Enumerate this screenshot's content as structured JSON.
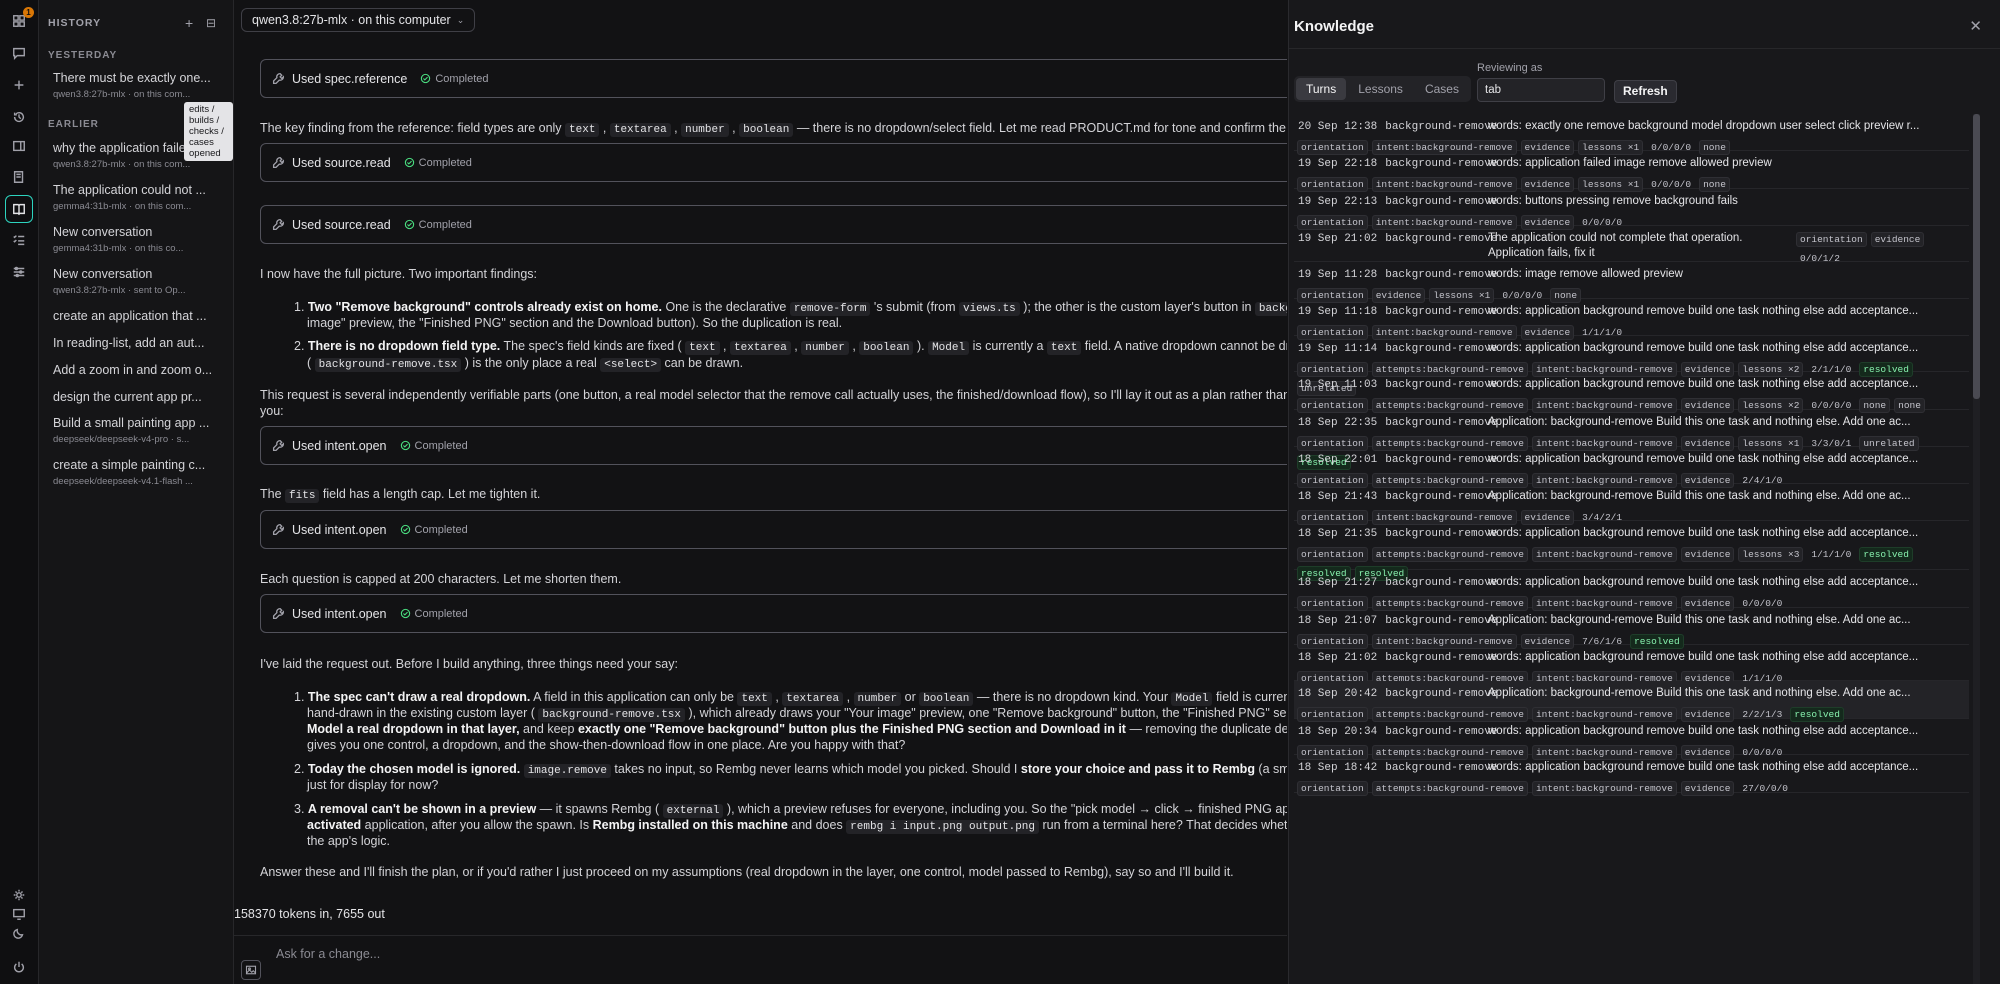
{
  "model_selector": "qwen3.8:27b-mlx · on this computer",
  "sidebar": {
    "title": "HISTORY",
    "tooltip": "edits / builds / checks / cases opened",
    "sections": {
      "yesterday": "YESTERDAY",
      "earlier": "EARLIER"
    },
    "items": [
      {
        "title": "There must be exactly one...",
        "sub": "qwen3.8:27b-mlx · on this com..."
      },
      {
        "title": "why the application failed i...",
        "sub": "qwen3.8:27b-mlx · on this com..."
      },
      {
        "title": "The application could not ...",
        "sub": "gemma4:31b-mlx · on this com..."
      },
      {
        "title": "New conversation",
        "sub": "gemma4:31b-mlx · on this co..."
      },
      {
        "title": "New conversation",
        "sub": "qwen3.8:27b-mlx · sent to Op..."
      },
      {
        "title": "create an application that ...",
        "sub": ""
      },
      {
        "title": "In reading-list, add an aut...",
        "sub": ""
      },
      {
        "title": "Add a zoom in and zoom o...",
        "sub": ""
      },
      {
        "title": "design the current app pr...",
        "sub": ""
      },
      {
        "title": "Build a small painting app ...",
        "sub": "deepseek/deepseek-v4-pro · s..."
      },
      {
        "title": "create a simple painting c...",
        "sub": "deepseek/deepseek-v4.1-flash ..."
      }
    ]
  },
  "chat": {
    "completed": "Completed",
    "tools": [
      "Used spec.reference",
      "Used source.read",
      "Used source.read",
      "Used intent.open",
      "Used intent.open",
      "Used intent.open"
    ],
    "m1": {
      "a": "The key finding from the reference: field types are only ",
      "c1": "text",
      "c2": "textarea",
      "c3": "number",
      "c4": "boolean",
      "b": " — there is no dropdown/select field. Let me read PRODUCT.md for tone and confirm the two-butt"
    },
    "m2": "I now have the full picture. Two important findings:",
    "f1": {
      "b": "Two \"Remove background\" controls already exist on home.",
      "t1": " One is the declarative ",
      "c1": "remove-form",
      "t2": " 's submit (from ",
      "c2": "views.ts",
      "t3": " ); the other is the custom layer's button in ",
      "c3": "background-re",
      "t4": "image\" preview, the \"Finished PNG\" section and the Download button). So the duplication is real."
    },
    "f2": {
      "b": "There is no dropdown field type.",
      "t1": " The spec's field kinds are fixed ( ",
      "c1": "text",
      "c2": "textarea",
      "c3": "number",
      "c4": "boolean",
      "t2": " ). ",
      "c5": "Model",
      "t3": " is currently a ",
      "c6": "text",
      "t4": " field. A native dropdown cannot be drawn from",
      "t5": "( ",
      "c7": "background-remove.tsx",
      "t6": " ) is the only place a real ",
      "c8": "<select>",
      "t7": " can be drawn."
    },
    "m3a": "This request is several independently verifiable parts (one button, a real model selector that the remove call actually uses, the finished/download flow), so I'll lay it out as a plan rather than start e",
    "m3b": "you:",
    "m4a": "The ",
    "m4c": "fits",
    "m4b": " field has a length cap. Let me tighten it.",
    "m5": "Each question is capped at 200 characters. Let me shorten them.",
    "m6": "I've laid the request out. Before I build anything, three things need your say:",
    "q1": {
      "b": "The spec can't draw a real dropdown.",
      "t1": " A field in this application can only be ",
      "c1": "text",
      "c2": "textarea",
      "c3": "number",
      "or": " or ",
      "c4": "boolean",
      "t2": " — there is no dropdown kind. Your ",
      "c5": "Model",
      "t3": " field is currently a pla",
      "l2a": "hand-drawn in the existing custom layer ( ",
      "c6": "background-remove.tsx",
      "l2b": " ), which already draws your \"Your image\" preview, one \"Remove background\" button, the \"Finished PNG\" section and th",
      "l3b": "Model a real dropdown in that layer,",
      "l3t": " and keep ",
      "l3b2": "exactly one \"Remove background\" button plus the Finished PNG section and Download in it",
      "l3t2": " — removing the duplicate declarative form a",
      "l4": "gives you one control, a dropdown, and the show-then-download flow in one place. Are you happy with that?"
    },
    "q2": {
      "b": "Today the chosen model is ignored.",
      "c1": "image.remove",
      "t1": " takes no input, so Rembg never learns which model you picked. Should I ",
      "b2": "store your choice and pass it to Rembg",
      "t2": " (a small new inpu",
      "l2": "just for display for now?"
    },
    "q3": {
      "b": "A removal can't be shown in a preview",
      "t1": " — it spawns Rembg ( ",
      "c1": "external",
      "t2": " ), which a preview refuses for everyone, including you. So the \"pick model → click → finished PNG appears → do",
      "l2b": "activated",
      "l2t": " application, after you allow the spawn. Is ",
      "l2b2": "Rembg installed on this machine",
      "l2t2": " and does ",
      "c2": "rembg i input.png output.png",
      "l2t3": " run from a terminal here? That decides whether a finishe",
      "l3": "the app's logic."
    },
    "m7": "Answer these and I'll finish the plan, or if you'd rather I just proceed on my assumptions (real dropdown in the layer, one control, model passed to Rembg), say so and I'll build it.",
    "tokens": "158370 tokens in, 7655 out",
    "composer_placeholder": "Ask for a change..."
  },
  "knowledge": {
    "title": "Knowledge",
    "tabs": [
      "Turns",
      "Lessons",
      "Cases"
    ],
    "reviewing_label": "Reviewing as",
    "reviewing_value": "tab",
    "refresh": "Refresh",
    "rows": [
      {
        "date": "20 Sep 12:38",
        "cat": "background-remove",
        "text": "words: exactly one remove background model dropdown user select click preview r...",
        "tags": [
          "orientation",
          "intent:background-remove",
          "evidence",
          "lessons ×1",
          "0/0/0/0",
          "none"
        ]
      },
      {
        "date": "19 Sep 22:18",
        "cat": "background-remove",
        "text": "words: application failed image remove allowed preview",
        "tags": [
          "orientation",
          "intent:background-remove",
          "evidence",
          "lessons ×1",
          "0/0/0/0",
          "none"
        ]
      },
      {
        "date": "19 Sep 22:13",
        "cat": "background-remove",
        "text": "words: buttons pressing remove background fails",
        "tags": [
          "orientation",
          "intent:background-remove",
          "evidence",
          "0/0/0/0"
        ]
      },
      {
        "date": "19 Sep 21:02",
        "cat": "background-remove",
        "text": "The application could not complete that operation.",
        "text2": "Application fails, fix it",
        "tags": []
      },
      {
        "date": "19 Sep 11:28",
        "cat": "background-remove",
        "text": "words: image remove allowed preview",
        "tags": [
          "orientation",
          "evidence",
          "lessons ×1",
          "0/0/0/0",
          "none"
        ]
      },
      {
        "date": "19 Sep 11:18",
        "cat": "background-remove",
        "text": "words: application background remove build one task nothing else add acceptance...",
        "tags": [
          "orientation",
          "intent:background-remove",
          "evidence",
          "1/1/1/0"
        ]
      },
      {
        "date": "19 Sep 11:14",
        "cat": "background-remove",
        "text": "words: application background remove build one task nothing else add acceptance...",
        "tags": [
          "orientation",
          "attempts:background-remove",
          "intent:background-remove",
          "evidence",
          "lessons ×2",
          "2/1/1/0",
          "resolved",
          "unrelated"
        ]
      },
      {
        "date": "19 Sep 11:03",
        "cat": "background-remove",
        "text": "words: application background remove build one task nothing else add acceptance...",
        "tags": [
          "orientation",
          "attempts:background-remove",
          "intent:background-remove",
          "evidence",
          "lessons ×2",
          "0/0/0/0",
          "none",
          "none"
        ]
      },
      {
        "date": "18 Sep 22:35",
        "cat": "background-remove",
        "text": "Application: background-remove Build this one task and nothing else. Add one ac...",
        "tags": [
          "orientation",
          "attempts:background-remove",
          "intent:background-remove",
          "evidence",
          "lessons ×1",
          "3/3/0/1",
          "unrelated",
          "resolved"
        ]
      },
      {
        "date": "18 Sep 22:01",
        "cat": "background-remove",
        "text": "words: application background remove build one task nothing else add acceptance...",
        "tags": [
          "orientation",
          "attempts:background-remove",
          "intent:background-remove",
          "evidence",
          "2/4/1/0"
        ]
      },
      {
        "date": "18 Sep 21:43",
        "cat": "background-remove",
        "text": "Application: background-remove Build this one task and nothing else. Add one ac...",
        "tags": [
          "orientation",
          "intent:background-remove",
          "evidence",
          "3/4/2/1"
        ]
      },
      {
        "date": "18 Sep 21:35",
        "cat": "background-remove",
        "text": "words: application background remove build one task nothing else add acceptance...",
        "tags": [
          "orientation",
          "attempts:background-remove",
          "intent:background-remove",
          "evidence",
          "lessons ×3",
          "1/1/1/0",
          "resolved",
          "resolved",
          "resolved"
        ]
      },
      {
        "date": "18 Sep 21:27",
        "cat": "background-remove",
        "text": "words: application background remove build one task nothing else add acceptance...",
        "tags": [
          "orientation",
          "attempts:background-remove",
          "intent:background-remove",
          "evidence",
          "0/0/0/0"
        ]
      },
      {
        "date": "18 Sep 21:07",
        "cat": "background-remove",
        "text": "Application: background-remove Build this one task and nothing else. Add one ac...",
        "tags": [
          "orientation",
          "intent:background-remove",
          "evidence",
          "7/6/1/6",
          "resolved"
        ]
      },
      {
        "date": "18 Sep 21:02",
        "cat": "background-remove",
        "text": "words: application background remove build one task nothing else add acceptance...",
        "tags": [
          "orientation",
          "attempts:background-remove",
          "intent:background-remove",
          "evidence",
          "1/1/1/0"
        ]
      },
      {
        "date": "18 Sep 20:42",
        "cat": "background-remove",
        "text": "Application: background-remove Build this one task and nothing else. Add one ac...",
        "tags": [
          "orientation",
          "attempts:background-remove",
          "intent:background-remove",
          "evidence",
          "2/2/1/3",
          "resolved"
        ]
      },
      {
        "date": "18 Sep 20:34",
        "cat": "background-remove",
        "text": "words: application background remove build one task nothing else add acceptance...",
        "tags": [
          "orientation",
          "attempts:background-remove",
          "intent:background-remove",
          "evidence",
          "0/0/0/0"
        ]
      },
      {
        "date": "18 Sep 18:42",
        "cat": "background-remove",
        "text": "words: application background remove build one task nothing else add acceptance...",
        "tags": [
          "orientation",
          "attempts:background-remove",
          "intent:background-remove",
          "evidence",
          "27/0/0/0"
        ]
      }
    ],
    "row4_tags": [
      "orientation",
      "evidence",
      "0/0/1/2"
    ]
  },
  "rail_badge": "1"
}
